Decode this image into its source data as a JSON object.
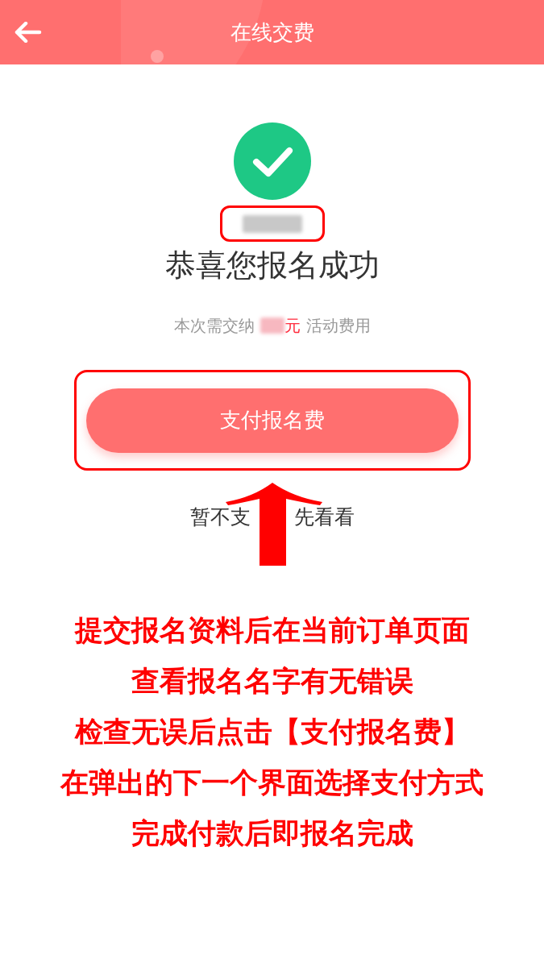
{
  "header": {
    "title": "在线交费"
  },
  "result": {
    "success": true,
    "heading": "恭喜您报名成功",
    "fee": {
      "prefix": "本次需交纳",
      "currency": "元",
      "suffix": "活动费用"
    }
  },
  "actions": {
    "pay_button": "支付报名费",
    "skip_link": [
      "暂不支",
      "先看看"
    ]
  },
  "annotations": {
    "name_highlighted": true,
    "button_highlighted": true,
    "arrow": true,
    "instructions": [
      "提交报名资料后在当前订单页面",
      "查看报名名字有无错误",
      "检查无误后点击【支付报名费】",
      "在弹出的下一个界面选择支付方式",
      "完成付款后即报名完成"
    ]
  }
}
